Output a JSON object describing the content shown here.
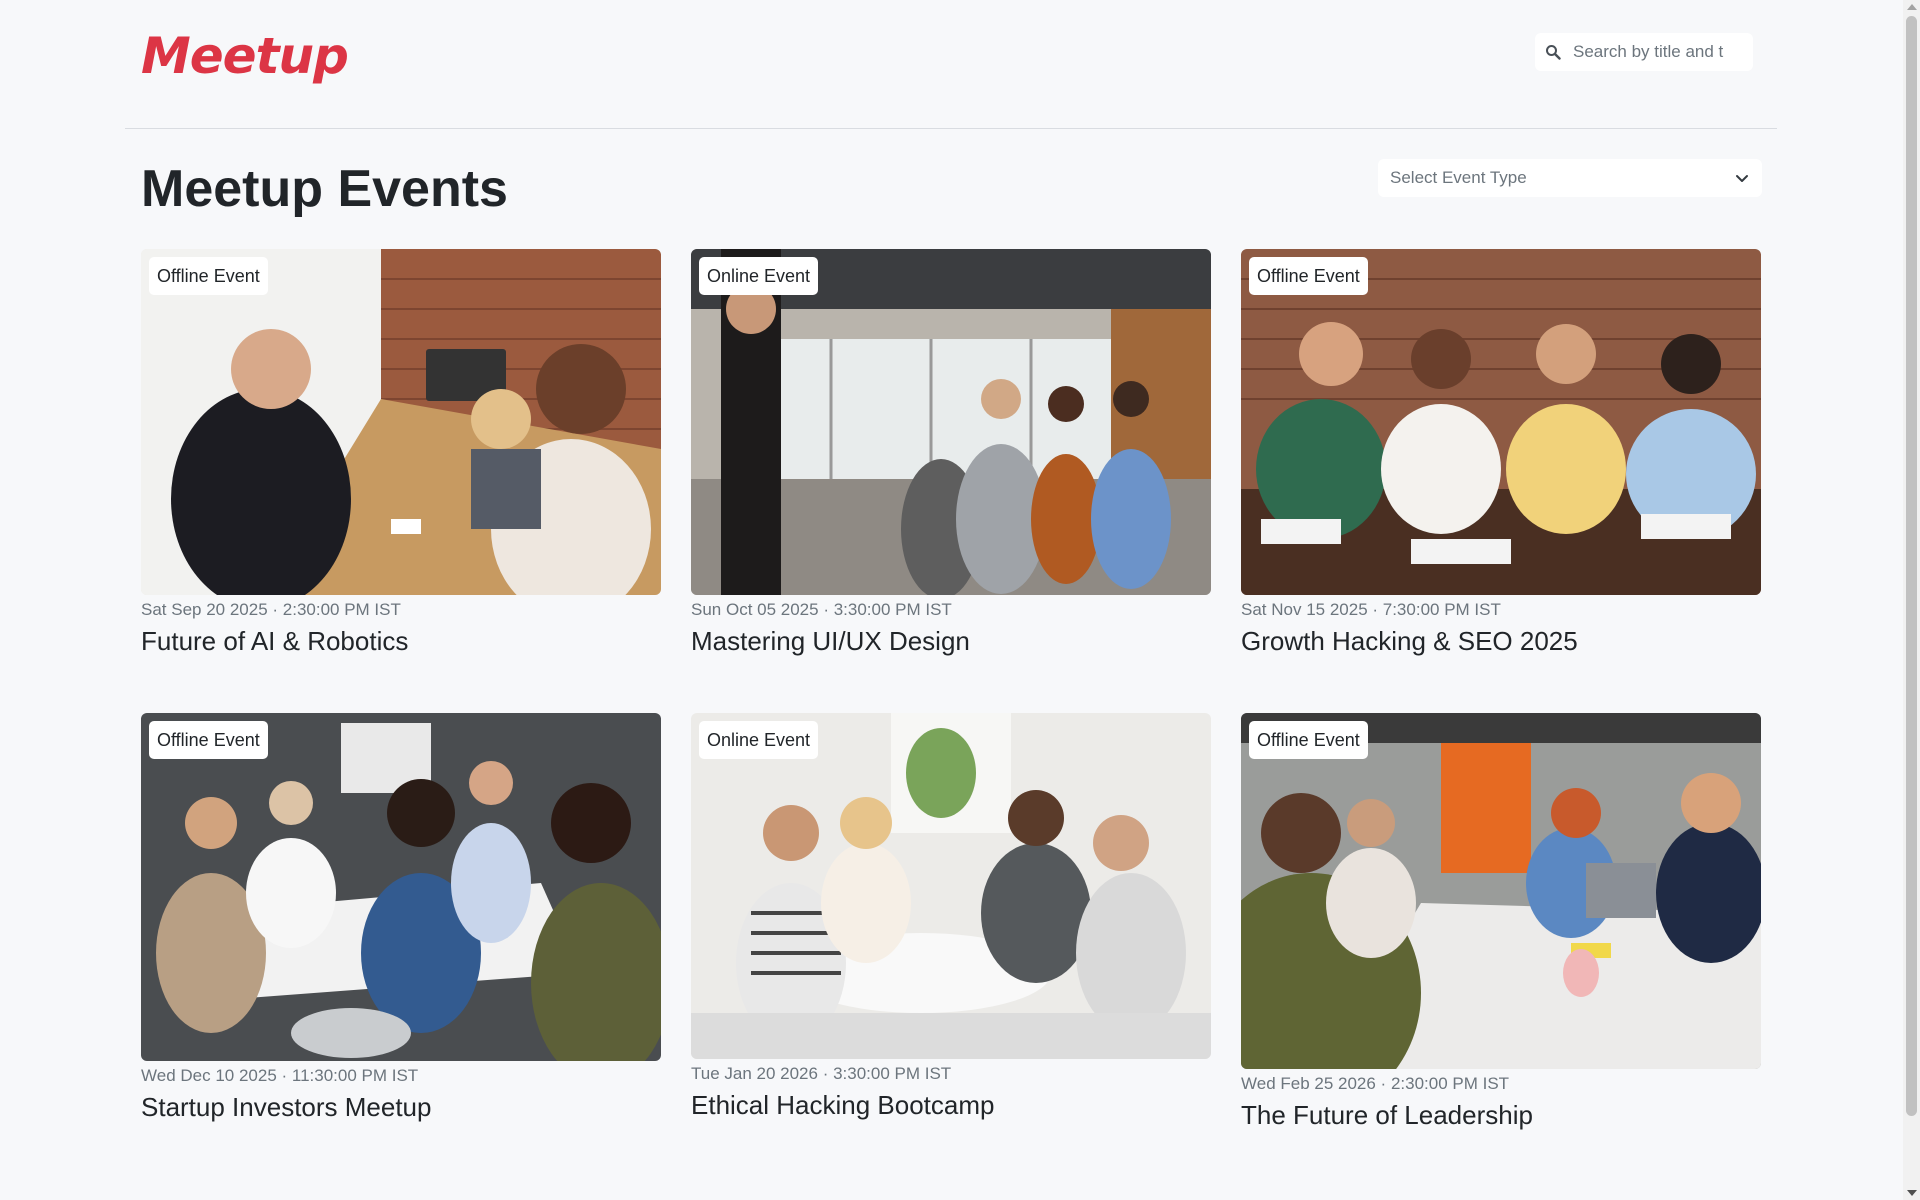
{
  "header": {
    "brand": "Meetup",
    "search_placeholder": "Search by title and t"
  },
  "main": {
    "page_title": "Meetup Events",
    "event_type_select": "Select Event Type"
  },
  "events": [
    {
      "badge": "Offline Event",
      "date": "Sat Sep 20 2025 · 2:30:00 PM IST",
      "title": "Future of AI & Robotics"
    },
    {
      "badge": "Online Event",
      "date": "Sun Oct 05 2025 · 3:30:00 PM IST",
      "title": "Mastering UI/UX Design"
    },
    {
      "badge": "Offline Event",
      "date": "Sat Nov 15 2025 · 7:30:00 PM IST",
      "title": "Growth Hacking & SEO 2025"
    },
    {
      "badge": "Offline Event",
      "date": "Wed Dec 10 2025 · 11:30:00 PM IST",
      "title": "Startup Investors Meetup"
    },
    {
      "badge": "Online Event",
      "date": "Tue Jan 20 2026 · 3:30:00 PM IST",
      "title": "Ethical Hacking Bootcamp"
    },
    {
      "badge": "Offline Event",
      "date": "Wed Feb 25 2026 · 2:30:00 PM IST",
      "title": "The Future of Leadership"
    }
  ],
  "colors": {
    "brand": "#dc3545",
    "background": "#f7f8fa",
    "text": "#212529",
    "muted": "#6c757d"
  },
  "icons": {
    "search": "search-icon",
    "select": "chevron-down-icon"
  }
}
